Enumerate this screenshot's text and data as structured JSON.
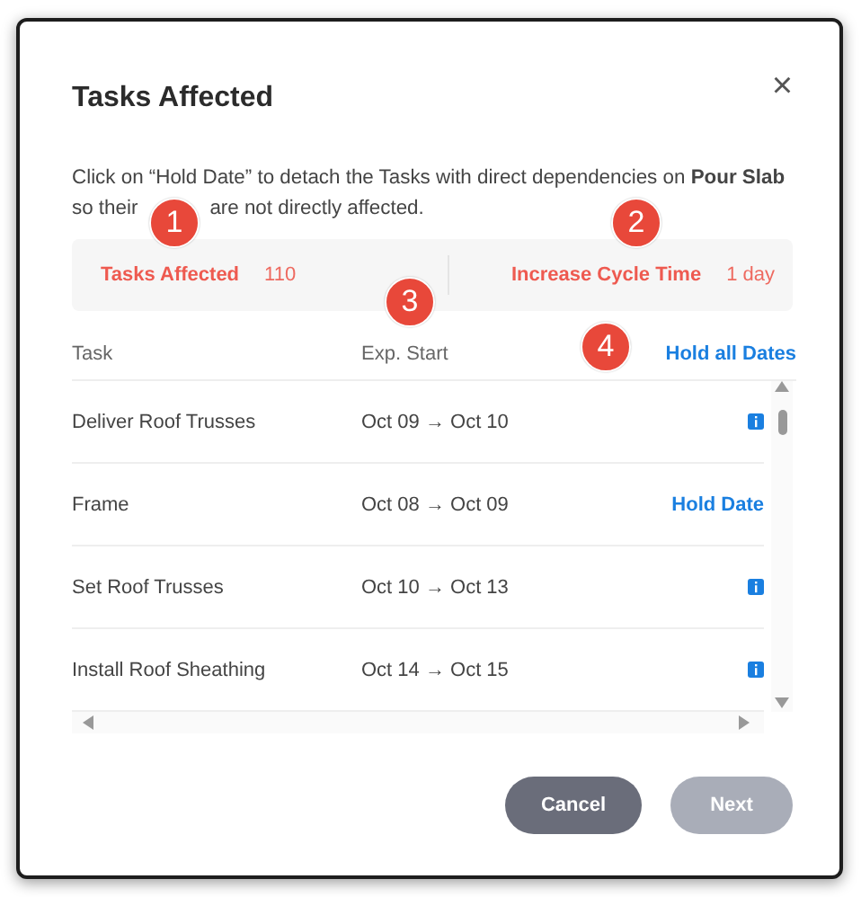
{
  "dialog": {
    "title": "Tasks Affected",
    "close": "×",
    "intro_before": "Click on “Hold Date” to detach the Tasks with direct dependencies on **Pour Slab**",
    "intro_middle": "so their",
    "intro_after": "are not directly affected.",
    "summary": [
      {
        "label": "Tasks Affected",
        "value": "110"
      },
      {
        "label": "Increase Cycle Time",
        "value": "1 day"
      }
    ],
    "table": {
      "columns": [
        "Task",
        "Exp. Start"
      ],
      "hold_all": "Hold all Dates",
      "rows": [
        {
          "task": "Deliver Roof Trusses",
          "dates": "Oct 09 → Oct 10",
          "kind": "info"
        },
        {
          "task": "Frame",
          "dates": "Oct 08 → Oct 09",
          "kind": "hold",
          "action": "Hold Date"
        },
        {
          "task": "Set Roof Trusses",
          "dates": "Oct 10 → Oct 13",
          "kind": "info"
        },
        {
          "task": "Install Roof Sheathing",
          "dates": "Oct 14 → Oct 15",
          "kind": "info"
        }
      ]
    },
    "buttons": [
      {
        "label": "Cancel",
        "disabled": false
      },
      {
        "label": "Next",
        "disabled": true
      }
    ]
  },
  "markers": [
    "1",
    "2",
    "3",
    "4"
  ]
}
